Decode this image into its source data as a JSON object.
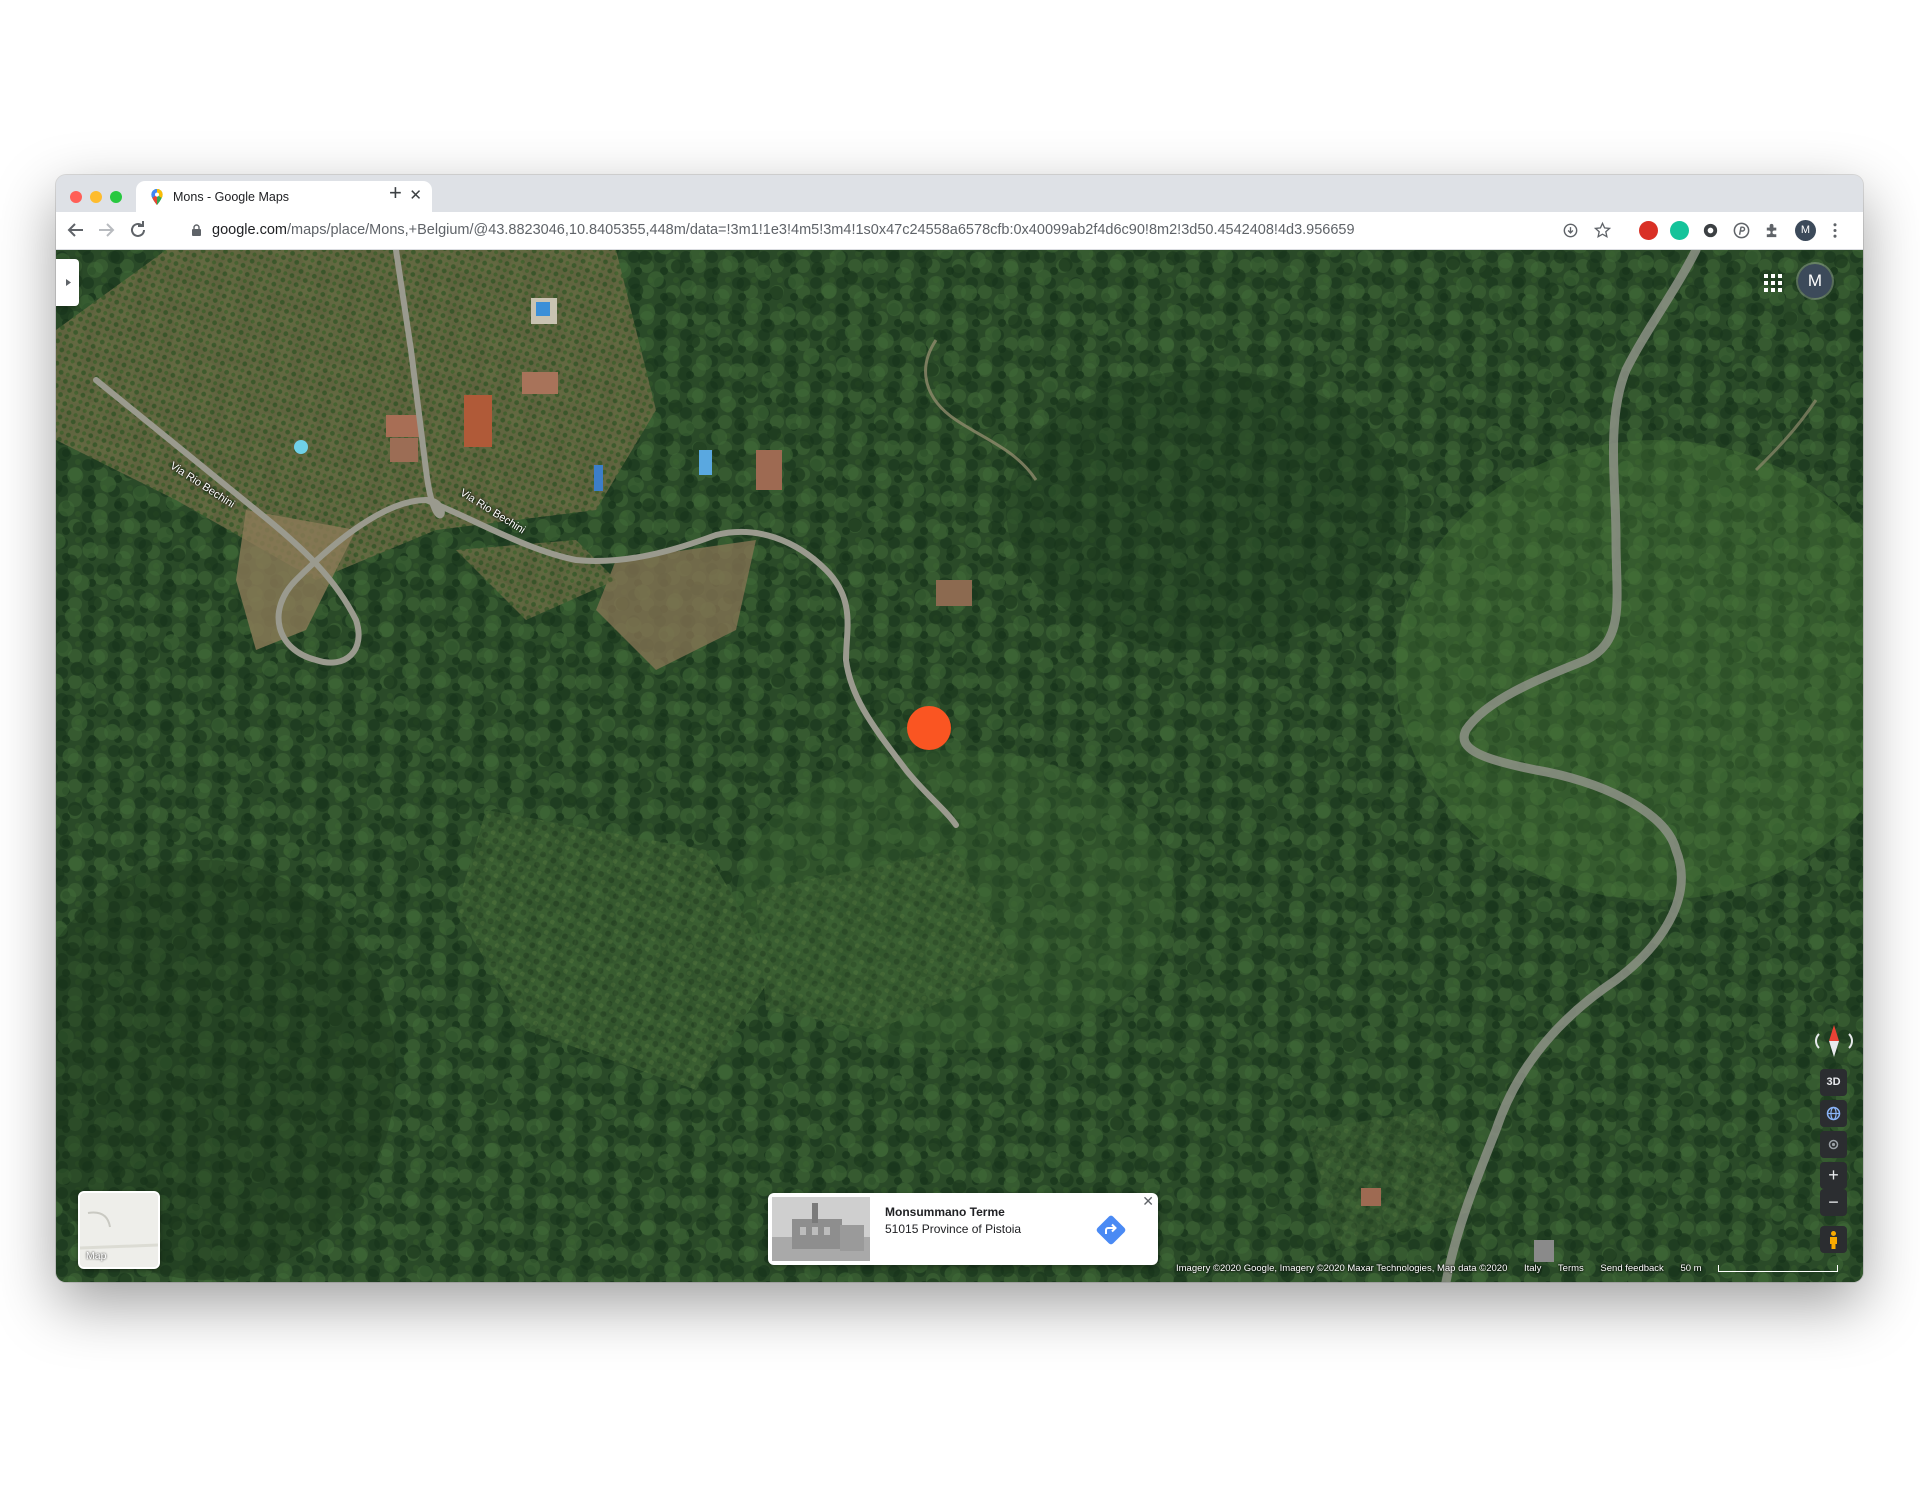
{
  "browser": {
    "tab_title": "Mons - Google Maps",
    "tab_close": "✕",
    "new_tab": "+",
    "url_host": "google.com",
    "url_path": "/maps/place/Mons,+Belgium/@43.8823046,10.8405355,448m/data=!3m1!1e3!4m5!3m4!1s0x47c24558a6578cfb:0x40099ab2f4d6c90!8m2!3d50.4542408!4d3.956659",
    "profile_initial": "M"
  },
  "map": {
    "view": "satellite",
    "avatar_initial": "M",
    "road_labels": [
      "Via Rio Bechini",
      "Via Rio Bechini"
    ],
    "marker_color": "#fa5522",
    "layer_switch_label": "Map",
    "info_card": {
      "title": "Monsummano Terme",
      "subtitle": "51015 Province of Pistoia"
    },
    "controls": {
      "tilt": "3D",
      "zoom_in": "+",
      "zoom_out": "−"
    },
    "attribution": {
      "imagery": "Imagery ©2020 Google, Imagery ©2020 Maxar Technologies, Map data ©2020",
      "country": "Italy",
      "terms": "Terms",
      "feedback": "Send feedback",
      "scale": "50 m"
    }
  },
  "icons": [
    "google-maps-favicon",
    "back-arrow",
    "forward-arrow",
    "reload",
    "lock",
    "install",
    "star",
    "extensions",
    "more-menu",
    "apps-grid",
    "directions",
    "compass",
    "globe",
    "locate",
    "pegman"
  ],
  "colors": {
    "accent": "#1a73e8",
    "marker": "#fa5522"
  }
}
